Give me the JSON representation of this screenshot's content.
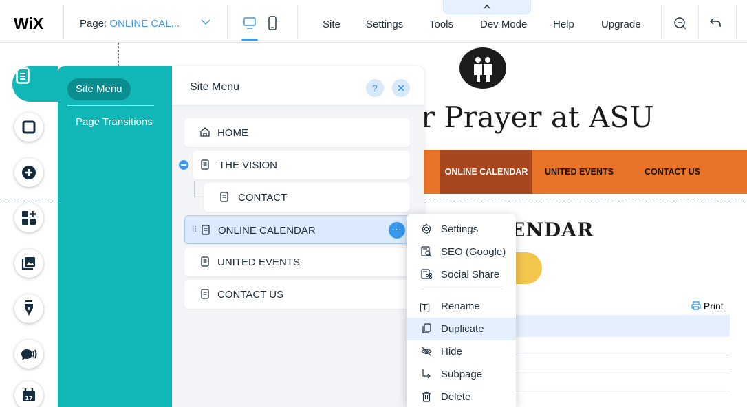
{
  "topbar": {
    "logo": "WiX",
    "page_label": "Page:",
    "page_value": "ONLINE CAL...",
    "menu": [
      "Site",
      "Settings",
      "Tools",
      "Dev Mode",
      "Help",
      "Upgrade"
    ],
    "accent": "#3899ec"
  },
  "canvas": {
    "site_title": "r Prayer at ASU",
    "nav": [
      "ONLINE CALENDAR",
      "UNITED EVENTS",
      "CONTACT US"
    ],
    "nav_active": "ONLINE CALENDAR",
    "heading": "ENDAR",
    "print_label": "Print",
    "colors": {
      "nav_bg": "#e8742a",
      "nav_active": "#a6461e",
      "button": "#f3c64e"
    }
  },
  "rail": {
    "items": [
      "pages-icon",
      "background-icon",
      "add-icon",
      "add-apps-icon",
      "media-icon",
      "blog-icon",
      "chat-icon",
      "events-icon"
    ]
  },
  "pages_panel": {
    "tabs": [
      "Site Menu",
      "Page Transitions"
    ],
    "active_tab": "Site Menu",
    "color": "#11b6b6"
  },
  "site_menu": {
    "title": "Site Menu",
    "help": "?",
    "pages": [
      {
        "label": "HOME",
        "icon": "home-icon",
        "level": 0
      },
      {
        "label": "THE VISION",
        "icon": "page-icon",
        "level": 0
      },
      {
        "label": "CONTACT",
        "icon": "page-icon",
        "level": 1
      },
      {
        "label": "ONLINE CALENDAR",
        "icon": "page-icon",
        "level": 0,
        "selected": true
      },
      {
        "label": "UNITED EVENTS",
        "icon": "page-icon",
        "level": 0
      },
      {
        "label": "CONTACT US",
        "icon": "page-icon",
        "level": 0
      }
    ],
    "more_label": "···"
  },
  "context_menu": {
    "items": [
      {
        "label": "Settings",
        "icon": "gear-icon"
      },
      {
        "label": "SEO (Google)",
        "icon": "seo-icon"
      },
      {
        "label": "Social Share",
        "icon": "share-icon"
      },
      {
        "label": "Rename",
        "icon": "rename-icon"
      },
      {
        "label": "Duplicate",
        "icon": "duplicate-icon",
        "hover": true
      },
      {
        "label": "Hide",
        "icon": "hide-icon"
      },
      {
        "label": "Subpage",
        "icon": "subpage-icon"
      },
      {
        "label": "Delete",
        "icon": "trash-icon"
      }
    ]
  }
}
